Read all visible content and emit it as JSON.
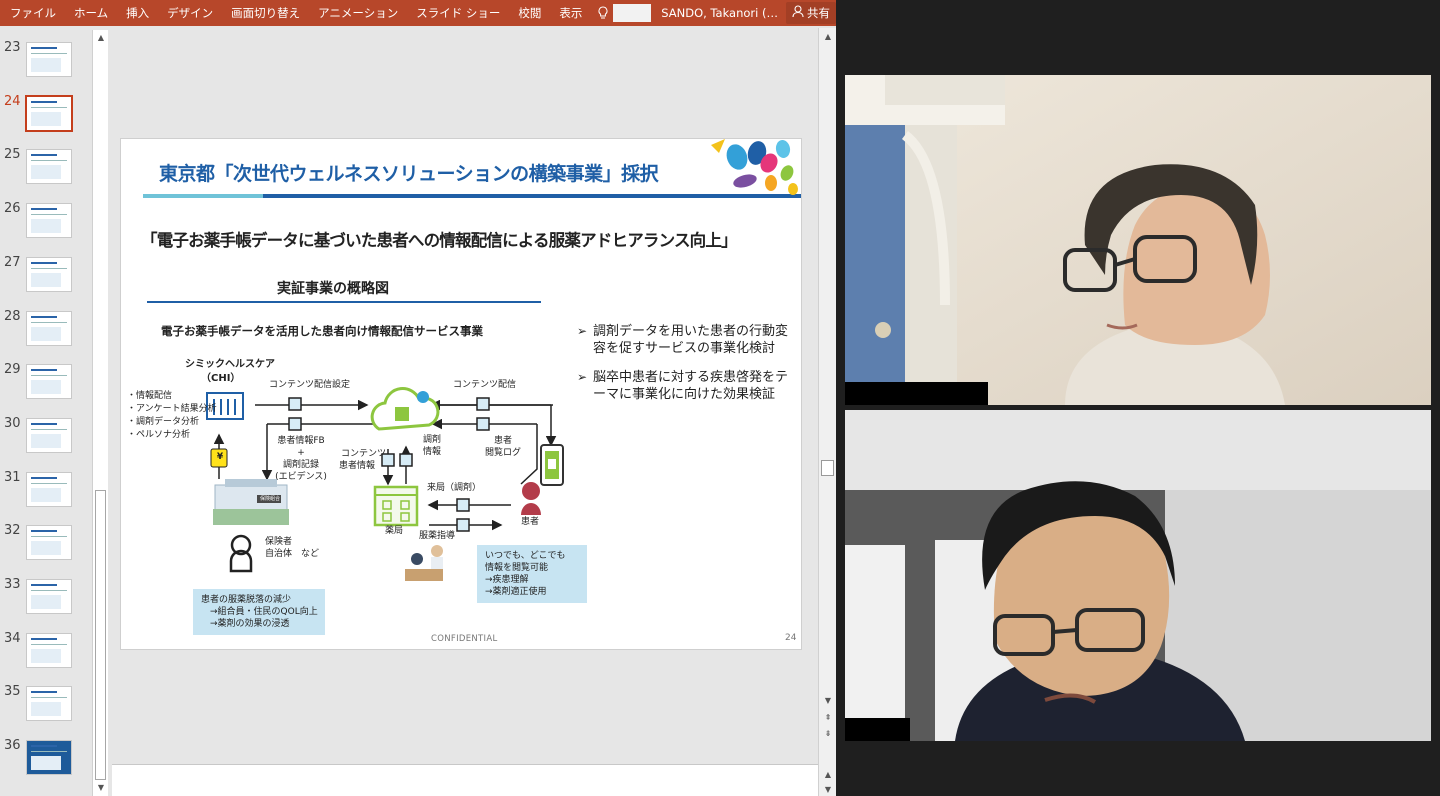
{
  "ribbon": {
    "tabs": [
      "ファイル",
      "ホーム",
      "挿入",
      "デザイン",
      "画面切り替え",
      "アニメーション",
      "スライド ショー",
      "校閲",
      "表示"
    ],
    "tellme_icon": "lightbulb-icon",
    "user": "SANDO, Takanori (…",
    "share_label": "共有",
    "share_icon": "person-share-icon",
    "accent_color": "#b7472a"
  },
  "thumbnails": {
    "selected": "24",
    "items": [
      {
        "num": "23"
      },
      {
        "num": "24"
      },
      {
        "num": "25"
      },
      {
        "num": "26"
      },
      {
        "num": "27"
      },
      {
        "num": "28"
      },
      {
        "num": "29"
      },
      {
        "num": "30"
      },
      {
        "num": "31"
      },
      {
        "num": "32"
      },
      {
        "num": "33"
      },
      {
        "num": "34"
      },
      {
        "num": "35"
      },
      {
        "num": "36"
      }
    ]
  },
  "slide": {
    "title": "東京都「次世代ウェルネスソリューションの構築事業」採択",
    "subtitle": "「電子お薬手帳データに基づいた患者への情報配信による服薬アドヒアランス向上」",
    "section_heading": "実証事業の概略図",
    "diagram_title": "電子お薬手帳データを活用した患者向け情報配信サービス事業",
    "bullets": [
      "調剤データを用いた患者の行動変容を促すサービスの事業化検討",
      "脳卒中患者に対する疾患啓発をテーマに事業化に向けた効果検証"
    ],
    "footer_confidential": "CONFIDENTIAL",
    "page_number": "24",
    "diagram": {
      "company": "シミックヘルスケア",
      "company_abbr": "（CHI）",
      "analysis": [
        "・情報配信",
        "・アンケート結果分析",
        "・調剤データ分析",
        "・ペルソナ分析"
      ],
      "content_setting": "コンテンツ配信設定",
      "content_delivery": "コンテンツ配信",
      "patient_fb": [
        "患者情報FB",
        "+",
        "調剤記録",
        "(エビデンス)"
      ],
      "content_patient_info": [
        "コンテンツ",
        "患者情報"
      ],
      "dispensing_info": [
        "調剤",
        "情報"
      ],
      "patient_view_log": [
        "患者",
        "閲覧ログ"
      ],
      "visit_label": "来局（調剤）",
      "medication_guidance": "服薬指導",
      "pharmacy": "薬局",
      "patient": "患者",
      "insurer": [
        "保険者",
        "自治体　など"
      ],
      "yen_symbol": "¥",
      "hospital_sign": "保険組合",
      "callout_patient": [
        "いつでも、どこでも",
        "情報を閲覧可能",
        "→疾患理解",
        "→薬剤適正使用"
      ],
      "callout_insurer": [
        "患者の服薬脱落の減少",
        "　→組合員・住民のQOL向上",
        "　→薬剤の効果の浸透"
      ]
    }
  },
  "participants": [
    {
      "label": "participant-top-video"
    },
    {
      "label": "participant-bottom-video"
    }
  ]
}
